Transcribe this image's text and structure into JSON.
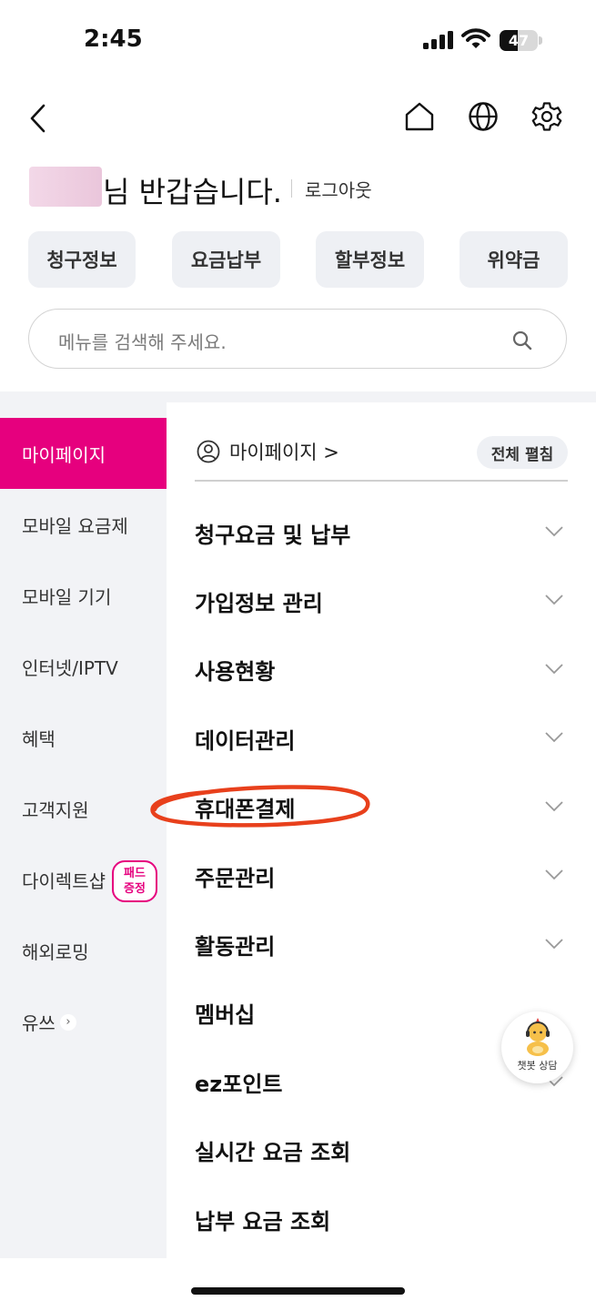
{
  "status_bar": {
    "time": "2:45",
    "battery": "47",
    "battery_level": 0.47
  },
  "header": {
    "greeting_suffix": "님 반갑습니다.",
    "logout_label": "로그아웃"
  },
  "quick_buttons": [
    "청구정보",
    "요금납부",
    "할부정보",
    "위약금"
  ],
  "search": {
    "placeholder": "메뉴를 검색해 주세요."
  },
  "sidebar": {
    "items": [
      {
        "label": "마이페이지",
        "active": true
      },
      {
        "label": "모바일 요금제"
      },
      {
        "label": "모바일 기기"
      },
      {
        "label": "인터넷/IPTV"
      },
      {
        "label": "혜택"
      },
      {
        "label": "고객지원"
      },
      {
        "label": "다이렉트샵"
      },
      {
        "label": "해외로밍"
      },
      {
        "label": "유쓰"
      }
    ],
    "badge_line1": "패드",
    "badge_line2": "증정",
    "youth_chevron": "›"
  },
  "main": {
    "breadcrumb": "마이페이지 >",
    "expand_all_label": "전체 펼침",
    "menu_items": [
      "청구요금 및 납부",
      "가입정보 관리",
      "사용현황",
      "데이터관리",
      "휴대폰결제",
      "주문관리",
      "활동관리",
      "멤버십",
      "ez포인트",
      "실시간 요금 조회",
      "납부 요금 조회"
    ]
  },
  "chatbot": {
    "label": "챗봇 상담"
  },
  "colors": {
    "accent": "#e6007e",
    "highlight_oval": "#e8401c",
    "sidebar_bg": "#f2f3f6"
  }
}
